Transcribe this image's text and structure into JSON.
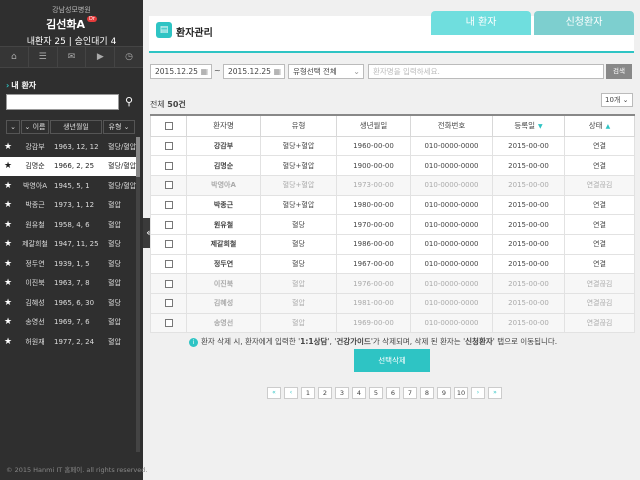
{
  "sidebar": {
    "hospital": "강남성모병원",
    "doctor": "김선화A",
    "doctor_badge": "Dr",
    "counts": "내환자 25  |  승인대기 4",
    "nav_icons": [
      "home-icon",
      "list-icon",
      "chat-icon",
      "video-icon",
      "clock-icon"
    ],
    "section_title": "내 환자",
    "columns": [
      "이름",
      "생년월일",
      "유형"
    ],
    "patients": [
      {
        "name": "강감부",
        "dob": "1963, 12, 12",
        "type": "혈당/혈압",
        "selected": false
      },
      {
        "name": "김명순",
        "dob": "1966, 2, 25",
        "type": "혈당/혈압",
        "selected": true
      },
      {
        "name": "박영아A",
        "dob": "1945, 5, 1",
        "type": "혈당/혈압",
        "selected": false
      },
      {
        "name": "박종근",
        "dob": "1973, 1, 12",
        "type": "혈압",
        "selected": false
      },
      {
        "name": "원유철",
        "dob": "1958, 4, 6",
        "type": "혈압",
        "selected": false
      },
      {
        "name": "제갈희철",
        "dob": "1947, 11, 25",
        "type": "혈당",
        "selected": false
      },
      {
        "name": "정두연",
        "dob": "1939, 1, 5",
        "type": "혈당",
        "selected": false
      },
      {
        "name": "이진북",
        "dob": "1963, 7, 8",
        "type": "혈압",
        "selected": false
      },
      {
        "name": "김혜성",
        "dob": "1965, 6, 30",
        "type": "혈당",
        "selected": false
      },
      {
        "name": "송영선",
        "dob": "1969, 7, 6",
        "type": "혈압",
        "selected": false
      },
      {
        "name": "허원재",
        "dob": "1977, 2, 24",
        "type": "혈압",
        "selected": false
      }
    ],
    "footer": "© 2015 Hanmi IT 홈페이. all rights reserved."
  },
  "header": {
    "title": "환자관리",
    "tab_mine": "내 환자",
    "tab_request": "신청환자"
  },
  "filters": {
    "date_from": "2015.12.25",
    "date_to": "2015.12.25",
    "tilde": "~",
    "type_select": "유형선택 전체",
    "search_placeholder": "환자명을 입력하세요.",
    "search_button": "검색"
  },
  "list": {
    "total_prefix": "전체 ",
    "total_count": "50건",
    "per_page": "10개",
    "columns": [
      "환자명",
      "유형",
      "생년월일",
      "전화번호",
      "등록일",
      "상태"
    ],
    "rows": [
      {
        "name": "강감부",
        "type": "혈당+혈압",
        "dob": "1960-00-00",
        "phone": "010-0000-0000",
        "reg": "2015-00-00",
        "status": "연결",
        "inactive": false
      },
      {
        "name": "김명순",
        "type": "혈당+혈압",
        "dob": "1900-00-00",
        "phone": "010-0000-0000",
        "reg": "2015-00-00",
        "status": "연결",
        "inactive": false
      },
      {
        "name": "박영아A",
        "type": "혈당+혈압",
        "dob": "1973-00-00",
        "phone": "010-0000-0000",
        "reg": "2015-00-00",
        "status": "연결끊김",
        "inactive": true
      },
      {
        "name": "박종근",
        "type": "혈당+혈압",
        "dob": "1980-00-00",
        "phone": "010-0000-0000",
        "reg": "2015-00-00",
        "status": "연결",
        "inactive": false
      },
      {
        "name": "원유철",
        "type": "혈당",
        "dob": "1970-00-00",
        "phone": "010-0000-0000",
        "reg": "2015-00-00",
        "status": "연결",
        "inactive": false
      },
      {
        "name": "제갈희철",
        "type": "혈당",
        "dob": "1986-00-00",
        "phone": "010-0000-0000",
        "reg": "2015-00-00",
        "status": "연결",
        "inactive": false
      },
      {
        "name": "정두연",
        "type": "혈당",
        "dob": "1967-00-00",
        "phone": "010-0000-0000",
        "reg": "2015-00-00",
        "status": "연결",
        "inactive": false
      },
      {
        "name": "이진북",
        "type": "혈압",
        "dob": "1976-00-00",
        "phone": "010-0000-0000",
        "reg": "2015-00-00",
        "status": "연결끊김",
        "inactive": true
      },
      {
        "name": "김혜성",
        "type": "혈압",
        "dob": "1981-00-00",
        "phone": "010-0000-0000",
        "reg": "2015-00-00",
        "status": "연결끊김",
        "inactive": true
      },
      {
        "name": "송영선",
        "type": "혈압",
        "dob": "1969-00-00",
        "phone": "010-0000-0000",
        "reg": "2015-00-00",
        "status": "연결끊김",
        "inactive": true
      }
    ]
  },
  "notice": {
    "t1": "환자 삭제 시, 환자에게 입력한 '",
    "b1": "1:1상담",
    "t2": "', '",
    "b2": "건강가이드",
    "t3": "'가 삭제되며, 삭제 된 환자는 '",
    "b3": "신청환자",
    "t4": "' 탭으로 이동됩니다."
  },
  "delete_button": "선택삭제",
  "pagination": {
    "first": "«",
    "prev": "‹",
    "pages": [
      "1",
      "2",
      "3",
      "4",
      "5",
      "6",
      "7",
      "8",
      "9",
      "10"
    ],
    "next": "›",
    "last": "»"
  },
  "colors": {
    "accent": "#2ec4c4",
    "sidebar_bg": "#2f2f2f"
  }
}
